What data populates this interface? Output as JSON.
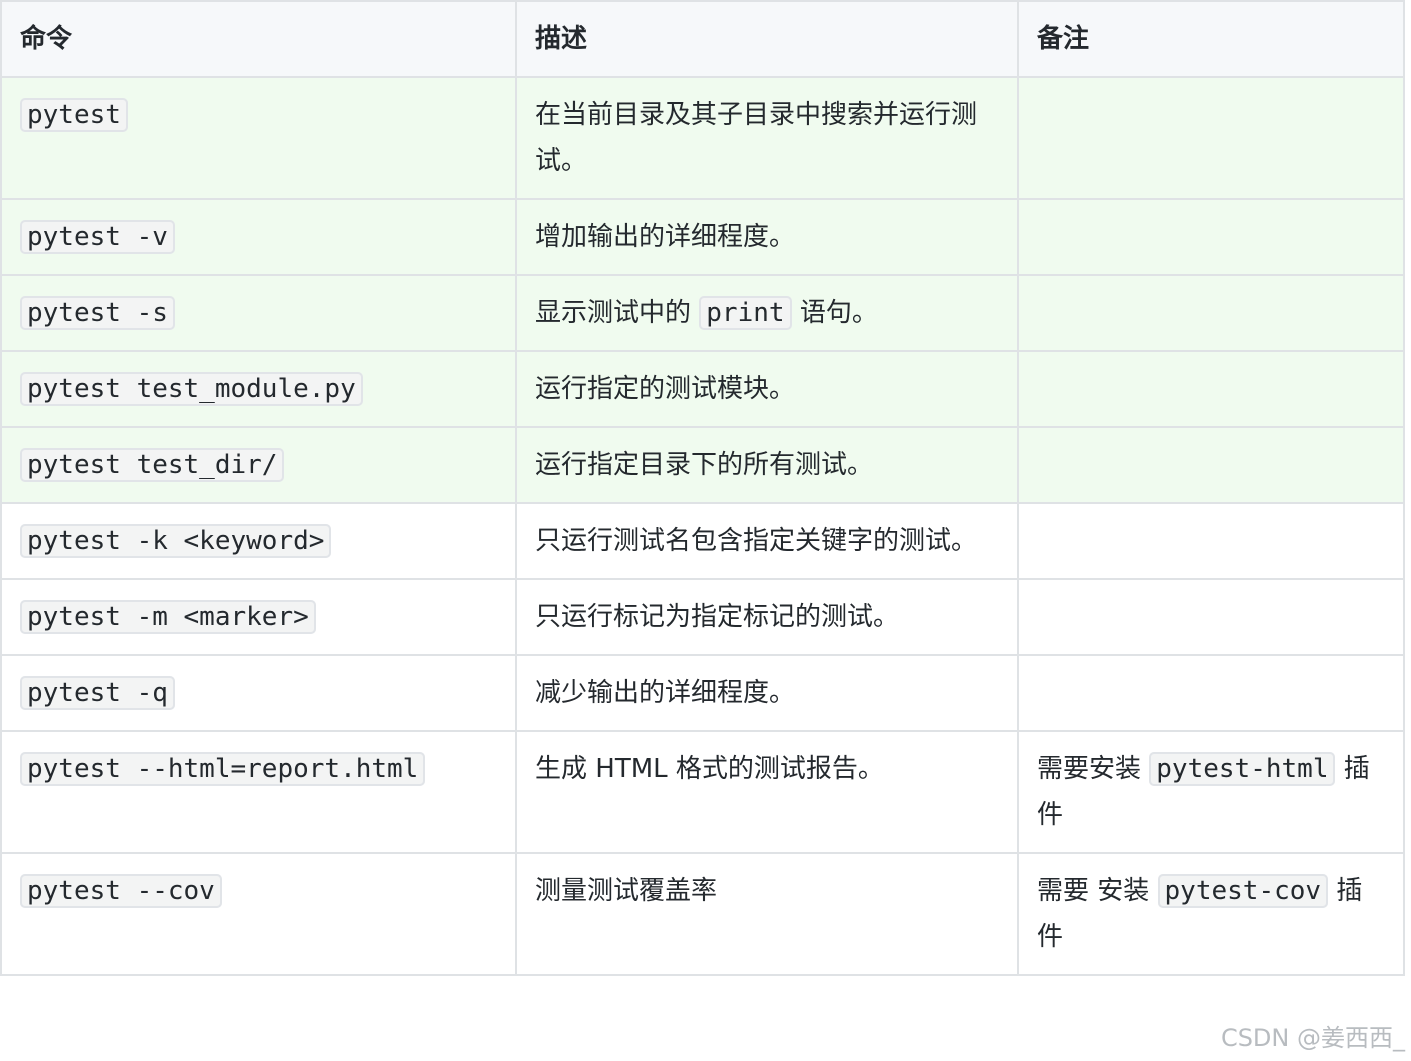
{
  "table": {
    "headers": [
      "命令",
      "描述",
      "备注"
    ],
    "rows": [
      {
        "command": "pytest",
        "desc_pre": "在当前目录及其子目录中搜索并运行测试。",
        "desc_code": "",
        "desc_post": "",
        "note_pre": "",
        "note_code": "",
        "note_post": "",
        "highlight": true
      },
      {
        "command": "pytest -v",
        "desc_pre": "增加输出的详细程度。",
        "desc_code": "",
        "desc_post": "",
        "note_pre": "",
        "note_code": "",
        "note_post": "",
        "highlight": true
      },
      {
        "command": "pytest -s",
        "desc_pre": "显示测试中的",
        "desc_code": "print",
        "desc_post": "语句。",
        "note_pre": "",
        "note_code": "",
        "note_post": "",
        "highlight": true
      },
      {
        "command": "pytest test_module.py",
        "desc_pre": "运行指定的测试模块。",
        "desc_code": "",
        "desc_post": "",
        "note_pre": "",
        "note_code": "",
        "note_post": "",
        "highlight": true
      },
      {
        "command": "pytest test_dir/",
        "desc_pre": "运行指定目录下的所有测试。",
        "desc_code": "",
        "desc_post": "",
        "note_pre": "",
        "note_code": "",
        "note_post": "",
        "highlight": true
      },
      {
        "command": "pytest -k <keyword>",
        "desc_pre": "只运行测试名包含指定关键字的测试。",
        "desc_code": "",
        "desc_post": "",
        "note_pre": "",
        "note_code": "",
        "note_post": "",
        "highlight": false
      },
      {
        "command": "pytest -m <marker>",
        "desc_pre": "只运行标记为指定标记的测试。",
        "desc_code": "",
        "desc_post": "",
        "note_pre": "",
        "note_code": "",
        "note_post": "",
        "highlight": false
      },
      {
        "command": "pytest -q",
        "desc_pre": "减少输出的详细程度。",
        "desc_code": "",
        "desc_post": "",
        "note_pre": "",
        "note_code": "",
        "note_post": "",
        "highlight": false
      },
      {
        "command": "pytest --html=report.html",
        "desc_pre": "生成 HTML 格式的测试报告。",
        "desc_code": "",
        "desc_post": "",
        "note_pre": "需要安装",
        "note_code": "pytest-html",
        "note_post": "插件",
        "highlight": false
      },
      {
        "command": "pytest --cov",
        "desc_pre": "测量测试覆盖率",
        "desc_code": "",
        "desc_post": "",
        "note_pre": "需要 安装",
        "note_code": "pytest-cov",
        "note_post": "插件",
        "highlight": false
      }
    ]
  },
  "watermark": "CSDN @姜西西_"
}
